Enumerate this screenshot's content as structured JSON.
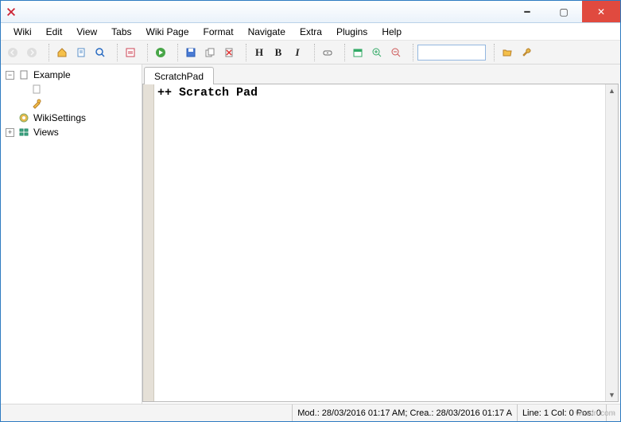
{
  "title": "",
  "menu": [
    "Wiki",
    "Edit",
    "View",
    "Tabs",
    "Wiki Page",
    "Format",
    "Navigate",
    "Extra",
    "Plugins",
    "Help"
  ],
  "toolbar": {
    "heading_label": "H",
    "bold_label": "B",
    "italic_label": "I",
    "search_value": ""
  },
  "tree": {
    "root": {
      "label": "Example"
    },
    "child_blank": {
      "label": ""
    },
    "child_scratch": {
      "label": ""
    },
    "wikisettings": {
      "label": "WikiSettings"
    },
    "views": {
      "label": "Views"
    }
  },
  "tabs": [
    {
      "label": "ScratchPad"
    }
  ],
  "editor_content": "++ Scratch Pad",
  "status": {
    "mod": "Mod.: 28/03/2016 01:17 AM; Crea.: 28/03/2016 01:17 A",
    "pos": "Line: 1 Col: 0 Pos: 0"
  },
  "watermark": "wsxdn.com"
}
